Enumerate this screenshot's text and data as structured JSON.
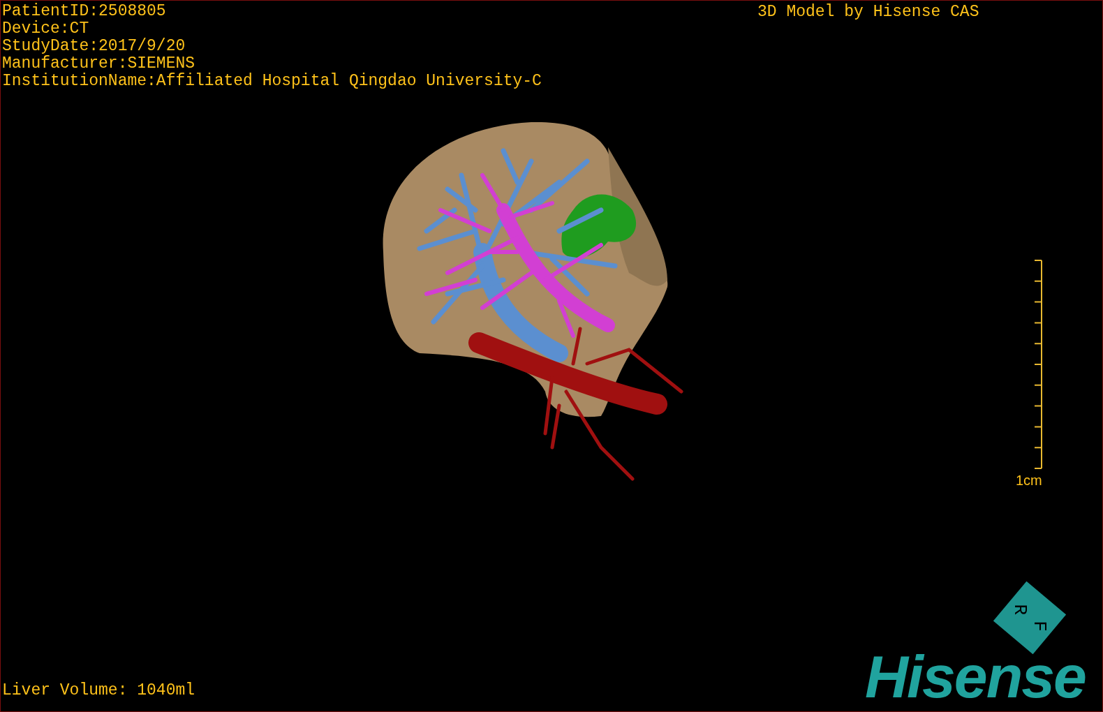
{
  "info_lines": [
    "PatientID:2508805",
    "Device:CT",
    "StudyDate:2017/9/20",
    "Manufacturer:SIEMENS",
    "InstitutionName:Affiliated Hospital Qingdao University-C"
  ],
  "title": "3D Model by Hisense CAS",
  "scale_bar": {
    "label": "1cm"
  },
  "orientation_cube": {
    "faces": [
      "R",
      "F"
    ]
  },
  "logo": "Hisense",
  "liver_volume": "Liver Volume: 1040ml"
}
